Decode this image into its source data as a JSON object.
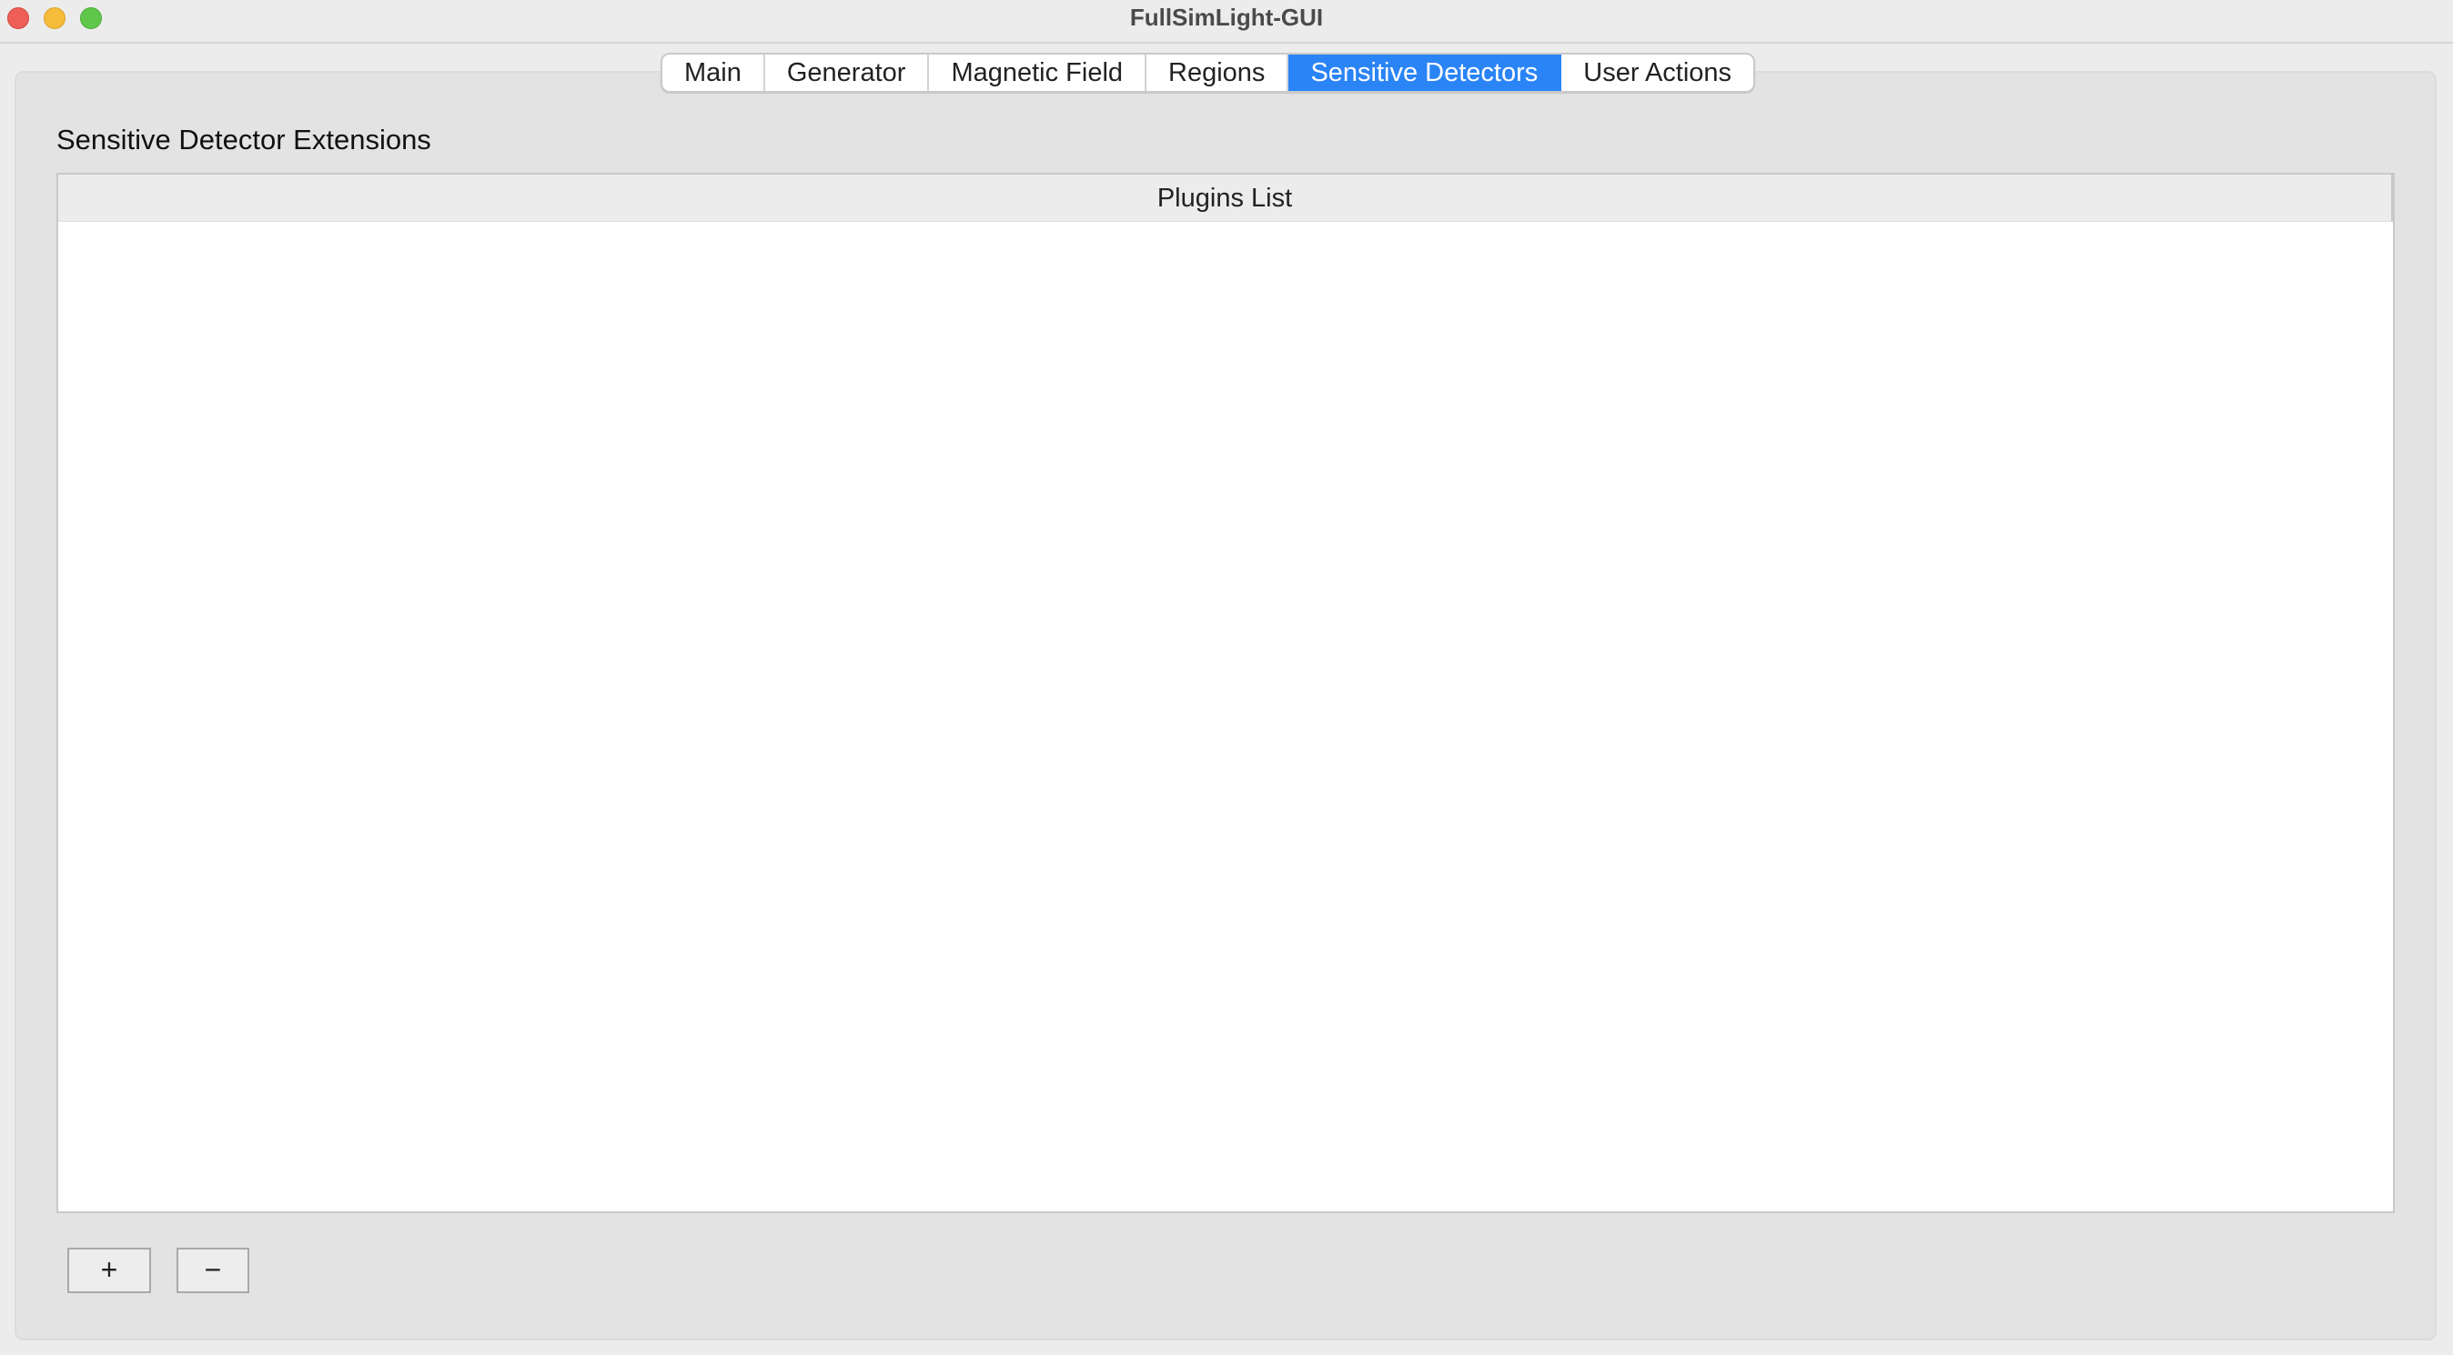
{
  "window": {
    "title": "FullSimLight-GUI"
  },
  "tabs": [
    {
      "label": "Main",
      "active": false
    },
    {
      "label": "Generator",
      "active": false
    },
    {
      "label": "Magnetic Field",
      "active": false
    },
    {
      "label": "Regions",
      "active": false
    },
    {
      "label": "Sensitive Detectors",
      "active": true
    },
    {
      "label": "User Actions",
      "active": false
    }
  ],
  "section": {
    "label": "Sensitive Detector Extensions"
  },
  "table": {
    "header": "Plugins List",
    "rows": []
  },
  "buttons": {
    "add_label": "+",
    "remove_label": "−"
  },
  "colors": {
    "accent": "#2a84f6",
    "close": "#ee5f57",
    "minimize": "#f6bd3b",
    "maximize": "#5fc84a"
  }
}
